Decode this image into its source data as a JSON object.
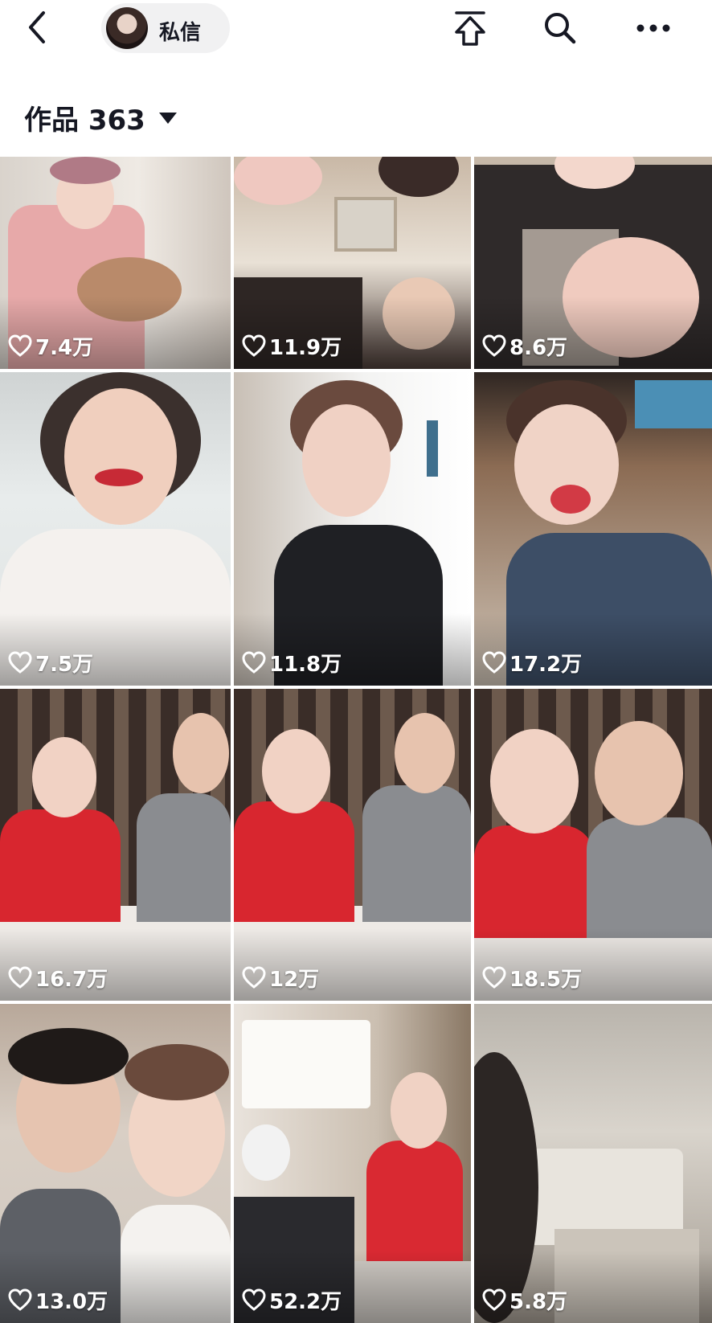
{
  "header": {
    "dm_label": "私信",
    "icons": [
      "back-icon",
      "share-icon",
      "search-icon",
      "more-icon"
    ]
  },
  "works": {
    "label": "作品 363"
  },
  "videos": [
    {
      "likes": "7.4万"
    },
    {
      "likes": "11.9万"
    },
    {
      "likes": "8.6万"
    },
    {
      "likes": "7.5万"
    },
    {
      "likes": "11.8万"
    },
    {
      "likes": "17.2万"
    },
    {
      "likes": "16.7万"
    },
    {
      "likes": "12万"
    },
    {
      "likes": "18.5万"
    },
    {
      "likes": "13.0万"
    },
    {
      "likes": "52.2万"
    },
    {
      "likes": "5.8万"
    }
  ],
  "colors": {
    "text": "#161823",
    "pill_bg": "#f1f1f2",
    "like_text": "#ffffff"
  }
}
